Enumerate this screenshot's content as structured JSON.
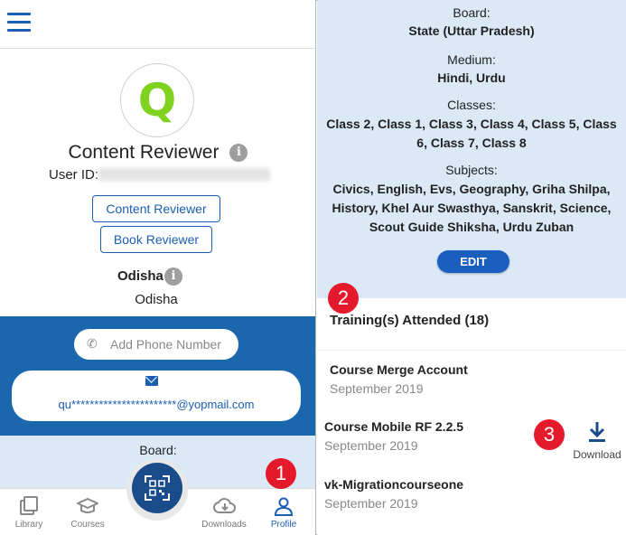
{
  "left": {
    "avatar_letter": "Q",
    "profile_name": "Content Reviewer",
    "user_id_label": "User ID:",
    "roles": [
      "Content Reviewer",
      "Book Reviewer"
    ],
    "state_label": "Odisha",
    "state_value": "Odisha",
    "phone_placeholder": "Add Phone Number",
    "email": "qu***********************@yopmail.com",
    "board_label": "Board:"
  },
  "bottom_nav": {
    "library": "Library",
    "courses": "Courses",
    "downloads": "Downloads",
    "profile": "Profile"
  },
  "markers": {
    "one": "1",
    "two": "2",
    "three": "3"
  },
  "right": {
    "board_label": "Board:",
    "board_value": "State (Uttar Pradesh)",
    "medium_label": "Medium:",
    "medium_value": "Hindi, Urdu",
    "classes_label": "Classes:",
    "classes_value": "Class 2, Class 1, Class 3, Class 4, Class 5, Class 6, Class 7, Class 8",
    "subjects_label": "Subjects:",
    "subjects_value": "Civics, English, Evs, Geography, Griha Shilpa, History, Khel Aur Swasthya, Sanskrit, Science, Scout Guide Shiksha, Urdu Zuban",
    "edit_label": "EDIT",
    "trainings_heading": "Training(s) Attended (18)",
    "courses": [
      {
        "title": "Course Merge Account",
        "date": "September 2019"
      },
      {
        "title": "Course Mobile RF 2.2.5",
        "date": "September 2019"
      },
      {
        "title": "vk-Migrationcourseone",
        "date": "September 2019"
      }
    ],
    "download_label": "Download"
  },
  "colors": {
    "primary": "#1a5fb4",
    "band": "#1a67ad",
    "light_blue": "#dbe9f7",
    "avatar_letter": "#7fd320",
    "marker": "#e4192b"
  }
}
